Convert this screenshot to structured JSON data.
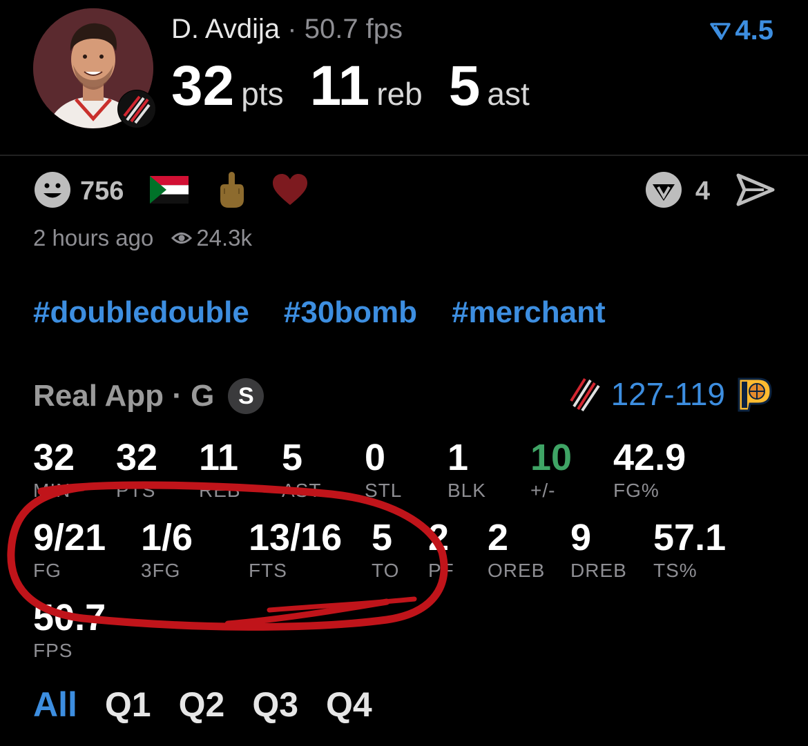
{
  "player": {
    "name": "D. Avdija",
    "separator": "·",
    "fps_label": "50.7 fps",
    "rank_value": "4.5",
    "rank_icon": "rank-chevron-icon",
    "points": "32",
    "points_unit": "pts",
    "rebounds": "11",
    "rebounds_unit": "reb",
    "assists": "5",
    "assists_unit": "ast"
  },
  "reactions": {
    "smiley_count": "756",
    "comment_count": "4",
    "items": [
      "smiley-icon",
      "sudan-flag-icon",
      "middle-finger-icon",
      "heart-icon"
    ]
  },
  "meta": {
    "time_ago": "2 hours ago",
    "views": "24.3k"
  },
  "hashtags": [
    "#doubledouble",
    "#30bomb",
    "#merchant"
  ],
  "game": {
    "source": "Real App · G",
    "badge": "S",
    "home_score": "127",
    "dash": "-",
    "away_score": "119"
  },
  "stats_row1": [
    {
      "value": "32",
      "label": "MIN"
    },
    {
      "value": "32",
      "label": "PTS"
    },
    {
      "value": "11",
      "label": "REB"
    },
    {
      "value": "5",
      "label": "AST"
    },
    {
      "value": "0",
      "label": "STL"
    },
    {
      "value": "1",
      "label": "BLK"
    },
    {
      "value": "10",
      "label": "+/-"
    },
    {
      "value": "42.9",
      "label": "FG%"
    }
  ],
  "stats_row2": [
    {
      "value": "9/21",
      "label": "FG"
    },
    {
      "value": "1/6",
      "label": "3FG"
    },
    {
      "value": "13/16",
      "label": "FTS"
    },
    {
      "value": "5",
      "label": "TO"
    },
    {
      "value": "2",
      "label": "PF"
    },
    {
      "value": "2",
      "label": "OREB"
    },
    {
      "value": "9",
      "label": "DREB"
    },
    {
      "value": "57.1",
      "label": "TS%"
    }
  ],
  "stats_row3": [
    {
      "value": "50.7",
      "label": "FPS"
    }
  ],
  "colors": {
    "accent_blue": "#3d8ee0",
    "positive_green": "#3fa465",
    "annotation_red": "#c0141a"
  },
  "tabs": [
    "All",
    "Q1",
    "Q2",
    "Q3",
    "Q4"
  ]
}
